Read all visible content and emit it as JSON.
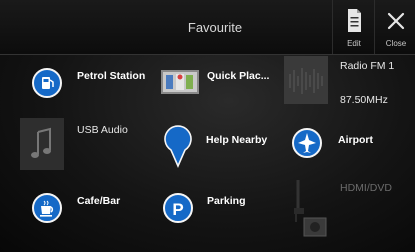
{
  "header": {
    "title": "Favourite",
    "edit_label": "Edit",
    "close_label": "Close"
  },
  "items": {
    "petrol_station": {
      "label": "Petrol Station"
    },
    "quick_place": {
      "label": "Quick Plac..."
    },
    "radio": {
      "label": "Radio FM 1",
      "frequency": "87.50MHz"
    },
    "usb_audio": {
      "label": "USB Audio"
    },
    "help_nearby": {
      "label": "Help Nearby"
    },
    "airport": {
      "label": "Airport"
    },
    "cafe_bar": {
      "label": "Cafe/Bar"
    },
    "parking": {
      "label": "Parking"
    },
    "hdmi_dvd": {
      "label": "HDMI/DVD"
    }
  },
  "colors": {
    "accent": "#1569c7",
    "background": "#141414"
  }
}
